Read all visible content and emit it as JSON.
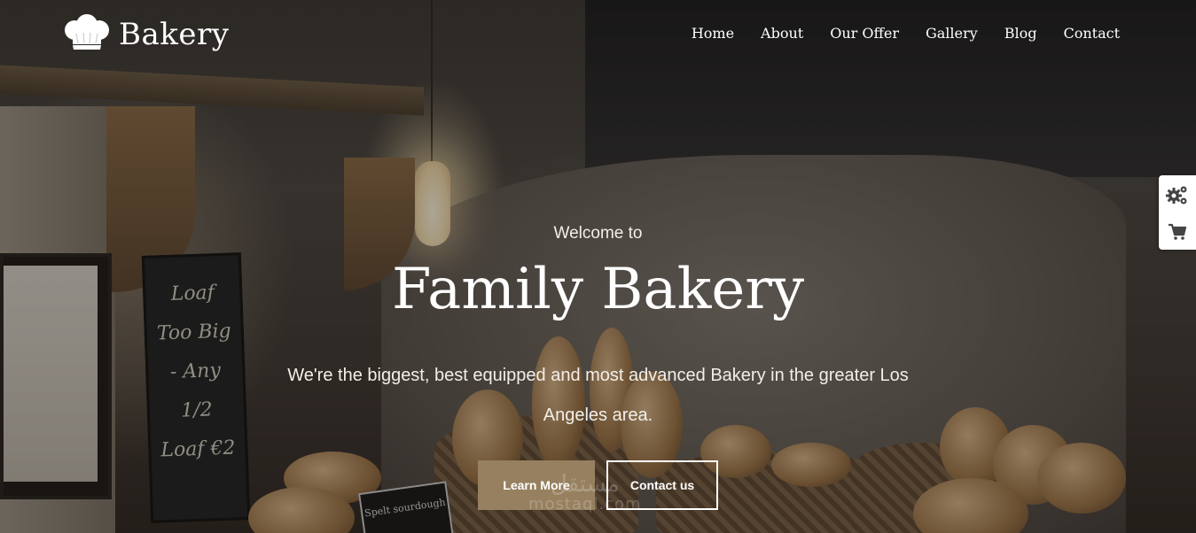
{
  "header": {
    "brand": "Bakery",
    "nav": [
      {
        "label": "Home"
      },
      {
        "label": "About"
      },
      {
        "label": "Our Offer"
      },
      {
        "label": "Gallery"
      },
      {
        "label": "Blog"
      },
      {
        "label": "Contact"
      }
    ]
  },
  "hero": {
    "welcome": "Welcome to",
    "title": "Family Bakery",
    "tagline": "We're the biggest, best equipped and most advanced Bakery in the greater Los Angeles area.",
    "primary_button": "Learn More",
    "secondary_button": "Contact us",
    "accent_color": "#96805f"
  },
  "background": {
    "chalkboard_text": "Loaf Too Big - Any 1/2 Loaf €2",
    "sign_text": "Spelt sourdough"
  },
  "side_widget": {
    "icons": [
      "gears-icon",
      "cart-icon"
    ]
  },
  "watermark": {
    "arabic": "مستقل",
    "latin": "mostaql.com"
  }
}
